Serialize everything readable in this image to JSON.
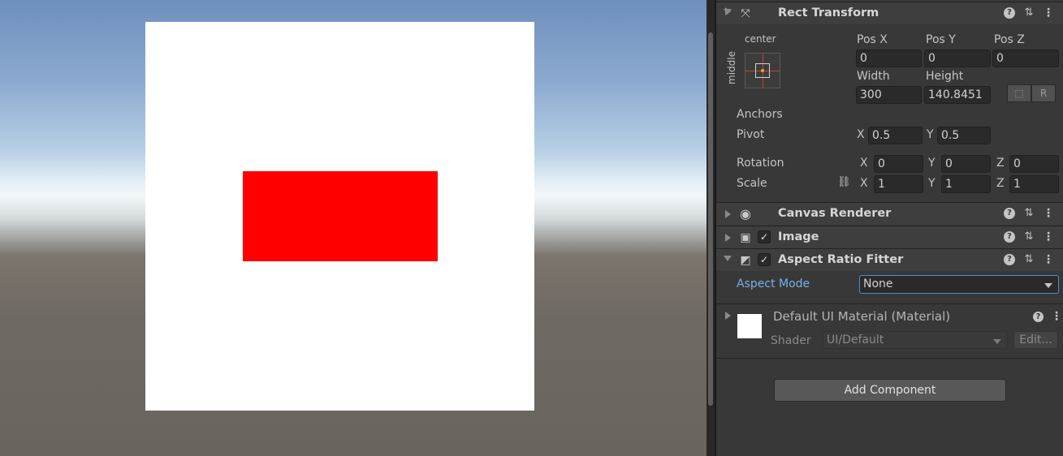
{
  "rect_transform": {
    "title": "Rect Transform",
    "anchor_h": "center",
    "anchor_v": "middle",
    "pos_x_label": "Pos X",
    "pos_y_label": "Pos Y",
    "pos_z_label": "Pos Z",
    "pos_x": "0",
    "pos_y": "0",
    "pos_z": "0",
    "width_label": "Width",
    "height_label": "Height",
    "width": "300",
    "height": "140.8451",
    "anchors_label": "Anchors",
    "pivot_label": "Pivot",
    "pivot_x": "0.5",
    "pivot_y": "0.5",
    "rotation_label": "Rotation",
    "rot_x": "0",
    "rot_y": "0",
    "rot_z": "0",
    "scale_label": "Scale",
    "scale_x": "1",
    "scale_y": "1",
    "scale_z": "1",
    "axis_x": "X",
    "axis_y": "Y",
    "axis_z": "Z",
    "raw_btn": "R"
  },
  "canvas_renderer": {
    "title": "Canvas Renderer"
  },
  "image": {
    "title": "Image"
  },
  "aspect_ratio_fitter": {
    "title": "Aspect Ratio Fitter",
    "mode_label": "Aspect Mode",
    "mode_value": "None"
  },
  "material": {
    "name": "Default UI Material (Material)",
    "shader_label": "Shader",
    "shader_value": "UI/Default",
    "edit_label": "Edit..."
  },
  "add_component_label": "Add Component",
  "colors": {
    "scene_panel": "#ffffff",
    "red_rect": "#ff0000",
    "accent": "#4a8fd6",
    "inspector_bg": "#383838"
  }
}
